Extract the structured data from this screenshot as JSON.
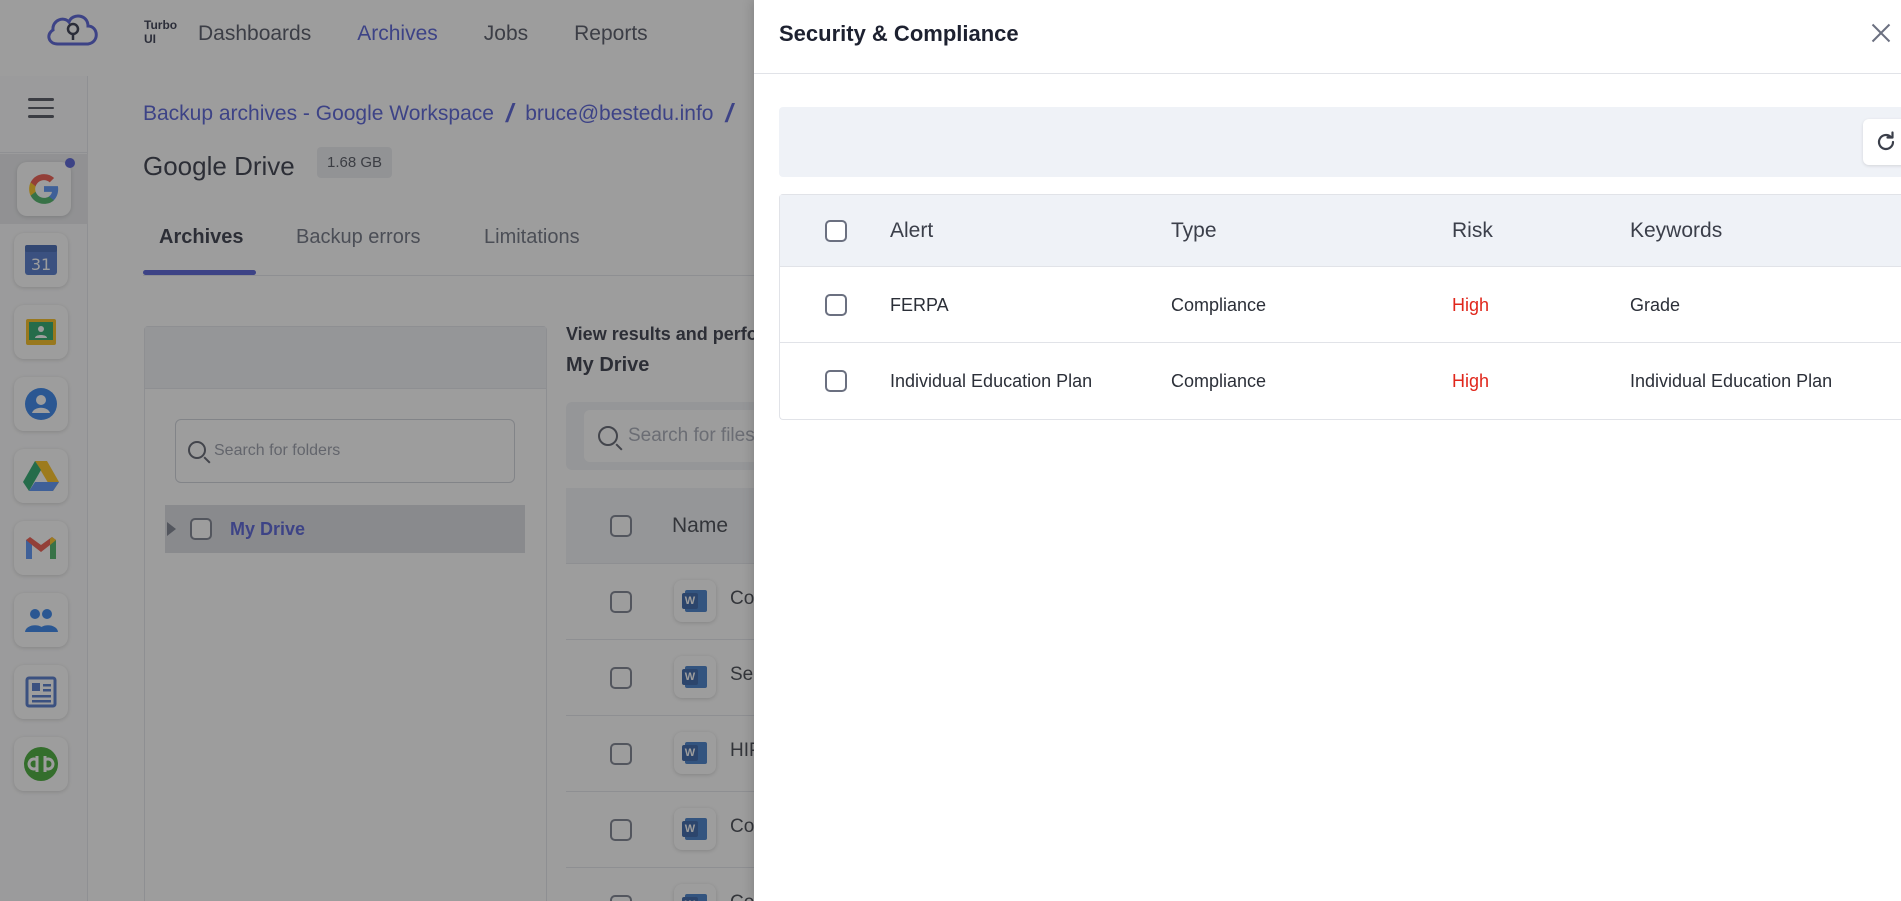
{
  "app": {
    "name": "Turbo UI"
  },
  "nav": {
    "items": [
      "Dashboards",
      "Archives",
      "Jobs",
      "Reports"
    ],
    "active": "Archives"
  },
  "rail": {
    "icons": [
      "menu-icon",
      "google-icon",
      "calendar-icon",
      "classroom-icon",
      "contacts-icon",
      "drive-icon",
      "gmail-icon",
      "groups-icon",
      "sites-icon",
      "quickbooks-icon"
    ],
    "calendar_day": "31"
  },
  "breadcrumb": {
    "items": [
      "Backup archives - Google Workspace",
      "bruce@bestedu.info"
    ],
    "separator": "/"
  },
  "page": {
    "title": "Google Drive",
    "size": "1.68 GB"
  },
  "tabs": [
    "Archives",
    "Backup errors",
    "Limitations"
  ],
  "folders": {
    "search_placeholder": "Search for folders",
    "tree_item": "My Drive"
  },
  "results": {
    "caption": "View results and perfor",
    "folder": "My Drive",
    "search_placeholder": "Search for files",
    "name_header": "Name",
    "rows": [
      "Co",
      "Ser",
      "HIP",
      "Co",
      "Co"
    ]
  },
  "drawer": {
    "title": "Security & Compliance",
    "columns": {
      "alert": "Alert",
      "type": "Type",
      "risk": "Risk",
      "keywords": "Keywords"
    },
    "rows": [
      {
        "alert": "FERPA",
        "type": "Compliance",
        "risk": "High",
        "keywords": "Grade"
      },
      {
        "alert": "Individual Education Plan",
        "type": "Compliance",
        "risk": "High",
        "keywords": "Individual Education Plan"
      }
    ]
  },
  "colors": {
    "accent": "#3f4ad1",
    "risk_high": "#e0261b",
    "overlay": "rgba(60,60,60,0.5)"
  }
}
